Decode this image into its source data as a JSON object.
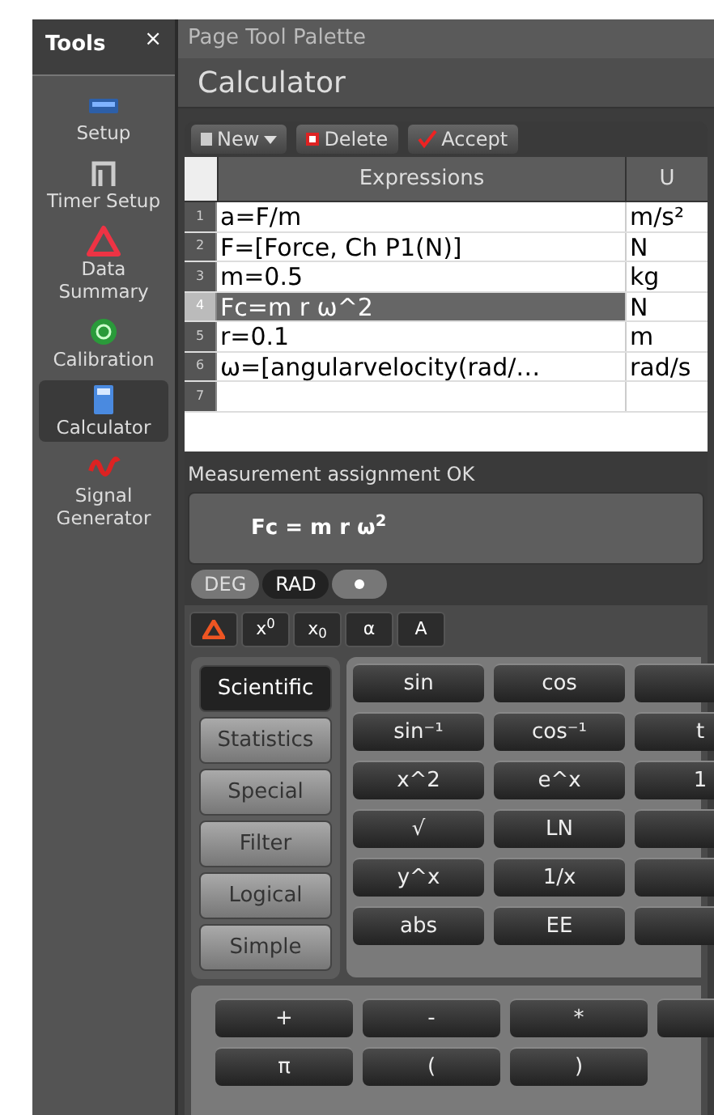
{
  "sidebar": {
    "title": "Tools",
    "close": "×",
    "items": [
      {
        "label": "Setup",
        "selected": false
      },
      {
        "label": "Timer Setup",
        "selected": false
      },
      {
        "label": "Data Summary",
        "selected": false
      },
      {
        "label": "Calibration",
        "selected": false
      },
      {
        "label": "Calculator",
        "selected": true
      },
      {
        "label": "Signal Generator",
        "selected": false
      }
    ]
  },
  "palette_title": "Page Tool Palette",
  "heading": "Calculator",
  "toolbar": [
    {
      "label": "New",
      "dropdown": true
    },
    {
      "label": "Delete",
      "dropdown": false
    },
    {
      "label": "Accept",
      "dropdown": false
    }
  ],
  "table": {
    "columns": [
      "Expressions",
      "U"
    ],
    "rows": [
      {
        "number": "1",
        "expression": "a=F/m",
        "unit": "m/s²",
        "selected": false
      },
      {
        "number": "2",
        "expression": "F=[Force, Ch P1(N)]",
        "unit": "N",
        "selected": false
      },
      {
        "number": "3",
        "expression": "m=0.5",
        "unit": "kg",
        "selected": false
      },
      {
        "number": "4",
        "expression": "Fc=m r ω^2",
        "unit": "N",
        "selected": true
      },
      {
        "number": "5",
        "expression": "r=0.1",
        "unit": "m",
        "selected": false
      },
      {
        "number": "6",
        "expression": "ω=[angularvelocity(rad/…",
        "unit": "rad/s",
        "selected": false
      },
      {
        "number": "7",
        "selected": false
      }
    ]
  },
  "status": "Measurement assignment OK",
  "formula": "Fc = m r ω$^{2}$",
  "angle_modes": [
    {
      "label": "DEG",
      "selected": false
    },
    {
      "label": "RAD",
      "selected": true
    }
  ],
  "insert_buttons": [
    {
      "kind": "icon"
    },
    {
      "kind": "text",
      "label": "x$^{0}$"
    },
    {
      "kind": "text",
      "label": "x$_{0}$"
    },
    {
      "kind": "text",
      "label": "α"
    },
    {
      "kind": "text",
      "label": "A"
    }
  ],
  "modes": [
    {
      "label": "Scientific",
      "selected": true
    },
    {
      "label": "Statistics",
      "selected": false
    },
    {
      "label": "Special",
      "selected": false
    },
    {
      "label": "Filter",
      "selected": false
    },
    {
      "label": "Logical",
      "selected": false
    },
    {
      "label": "Simple",
      "selected": false
    }
  ],
  "function_keys": [
    [
      "sin",
      "cos"
    ],
    [
      "sin⁻¹",
      "cos⁻¹",
      "t"
    ],
    [
      "x^2",
      "e^x",
      "1"
    ],
    [
      "√",
      "LN"
    ],
    [
      "y^x",
      "1/x"
    ],
    [
      "abs",
      "EE"
    ]
  ],
  "operator_keys": [
    [
      "+",
      "-",
      "*"
    ],
    [
      "π",
      "(",
      ")"
    ]
  ]
}
